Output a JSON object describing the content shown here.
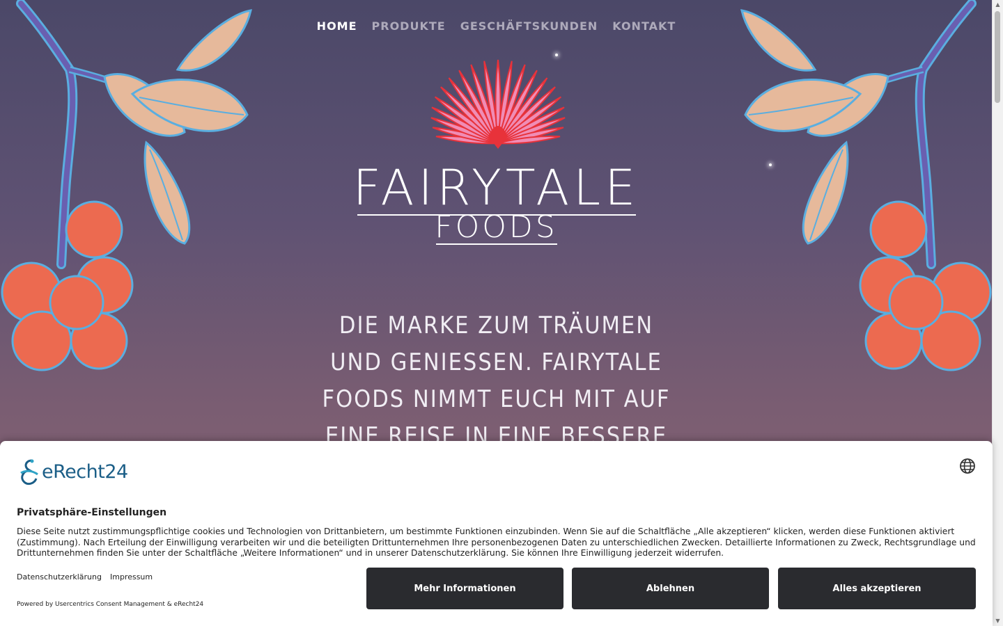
{
  "nav": {
    "items": [
      {
        "label": "HOME",
        "active": true
      },
      {
        "label": "PRODUKTE",
        "active": false
      },
      {
        "label": "GESCHÄFTSKUNDEN",
        "active": false
      },
      {
        "label": "KONTAKT",
        "active": false
      }
    ]
  },
  "brand": {
    "line1": "FAIRYTALE",
    "line2": "FOODS"
  },
  "tagline": {
    "lines": [
      "DIE MARKE ZUM TRÄUMEN",
      "UND GENIESSEN. FAIRYTALE",
      "FOODS NIMMT EUCH MIT AUF",
      "EINE REISE IN EINE BESSERE"
    ]
  },
  "consent": {
    "logo_text": "eRecht24",
    "title": "Privatsphäre-Einstellungen",
    "body": "Diese Seite nutzt zustimmungspflichtige cookies und Technologien von Drittanbietern, um bestimmte Funktionen einzubinden. Wenn Sie auf die Schaltfläche „Alle akzeptieren“ klicken, werden diese Funktionen aktiviert (Zustimmung). Nach Erteilung der Einwilligung verarbeiten wir und die beteiligten Drittunternehmen Ihre personenbezogenen Daten zu unterschiedlichen Zwecken. Detaillierte Informationen zu Zweck, Rechtsgrundlage und Drittunternehmen finden Sie unter der Schaltfläche „Weitere Informationen“ und in unserer Datenschutzerklärung. Sie können Ihre Einwilligung jederzeit widerrufen.",
    "link_privacy": "Datenschutzerklärung",
    "link_imprint": "Impressum",
    "powered_by": "Powered by Usercentrics Consent Management & eRecht24",
    "btn_more": "Mehr Informationen",
    "btn_decline": "Ablehnen",
    "btn_accept": "Alles akzeptieren"
  },
  "icons": {
    "language": "globe-icon",
    "logo": "fan-flower-icon"
  },
  "colors": {
    "bg_top": "#4b4868",
    "bg_bottom": "#8b6573",
    "petal_pink": "#f08cb5",
    "petal_red": "#e8323a",
    "leaf": "#e6b99b",
    "leaf_outline": "#5aaee0",
    "berry": "#ec6a50",
    "button_dark": "#2a2b2f",
    "erecht_blue": "#1b5e87"
  }
}
